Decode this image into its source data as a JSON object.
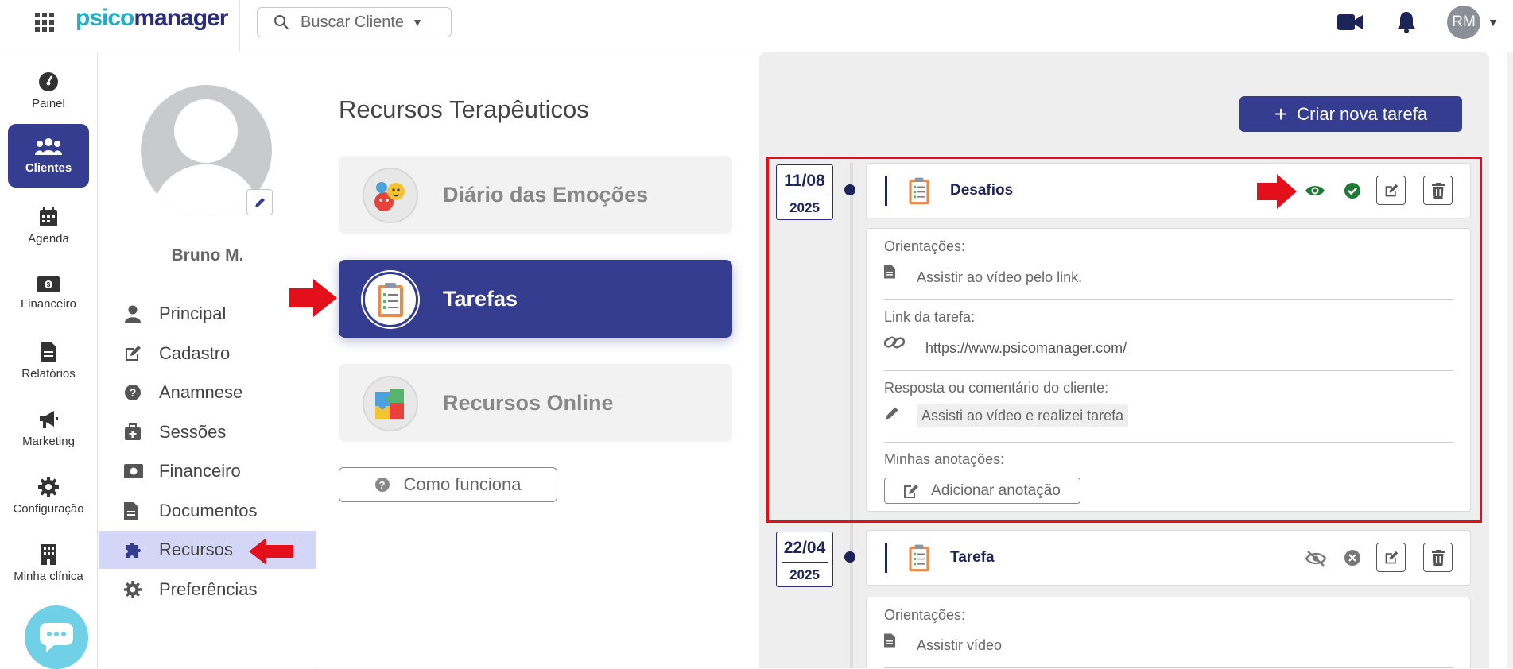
{
  "app": {
    "logo_part1": "psico",
    "logo_part2": "manager",
    "search_placeholder": "Buscar Cliente",
    "user_initials": "RM"
  },
  "leftnav": {
    "items": [
      {
        "label": "Painel",
        "icon": "gauge-icon"
      },
      {
        "label": "Clientes",
        "icon": "users-icon",
        "active": true
      },
      {
        "label": "Agenda",
        "icon": "calendar-icon"
      },
      {
        "label": "Financeiro",
        "icon": "money-icon"
      },
      {
        "label": "Relatórios",
        "icon": "document-icon"
      },
      {
        "label": "Marketing",
        "icon": "megaphone-icon"
      },
      {
        "label": "Configuração",
        "icon": "gear-icon"
      },
      {
        "label": "Minha clínica",
        "icon": "building-icon"
      }
    ]
  },
  "client": {
    "name": "Bruno M.",
    "menu": [
      {
        "label": "Principal",
        "icon": "person-icon"
      },
      {
        "label": "Cadastro",
        "icon": "edit-icon"
      },
      {
        "label": "Anamnese",
        "icon": "question-icon"
      },
      {
        "label": "Sessões",
        "icon": "medkit-icon"
      },
      {
        "label": "Financeiro",
        "icon": "money-icon"
      },
      {
        "label": "Documentos",
        "icon": "document-icon"
      },
      {
        "label": "Recursos",
        "icon": "puzzle-icon",
        "active": true
      },
      {
        "label": "Preferências",
        "icon": "gear-icon"
      }
    ]
  },
  "resources": {
    "title": "Recursos Terapêuticos",
    "cards": [
      {
        "label": "Diário das Emoções",
        "icon": "emotions-icon"
      },
      {
        "label": "Tarefas",
        "icon": "clipboard-icon",
        "active": true
      },
      {
        "label": "Recursos Online",
        "icon": "puzzle-blocks-icon"
      }
    ],
    "how_it_works": "Como funciona"
  },
  "tasks": {
    "new_task_label": "Criar nova tarefa",
    "items": [
      {
        "date_dm": "11/08",
        "date_year": "2025",
        "name": "Desafios",
        "visible": true,
        "completed": true,
        "guidance_label": "Orientações:",
        "guidance": "Assistir ao vídeo pelo link.",
        "link_label": "Link da tarefa:",
        "link": "https://www.psicomanager.com/",
        "answer_label": "Resposta ou comentário do cliente:",
        "answer": "Assisti ao vídeo e realizei tarefa",
        "notes_label": "Minhas anotações:",
        "add_note": "Adicionar anotação"
      },
      {
        "date_dm": "22/04",
        "date_year": "2025",
        "name": "Tarefa",
        "visible": false,
        "completed": false,
        "guidance_label": "Orientações:",
        "guidance": "Assistir vídeo"
      }
    ]
  },
  "colors": {
    "primary": "#343d8f",
    "accent": "#1fb0c9",
    "highlight": "#e3101c",
    "success": "#1e7a36"
  }
}
